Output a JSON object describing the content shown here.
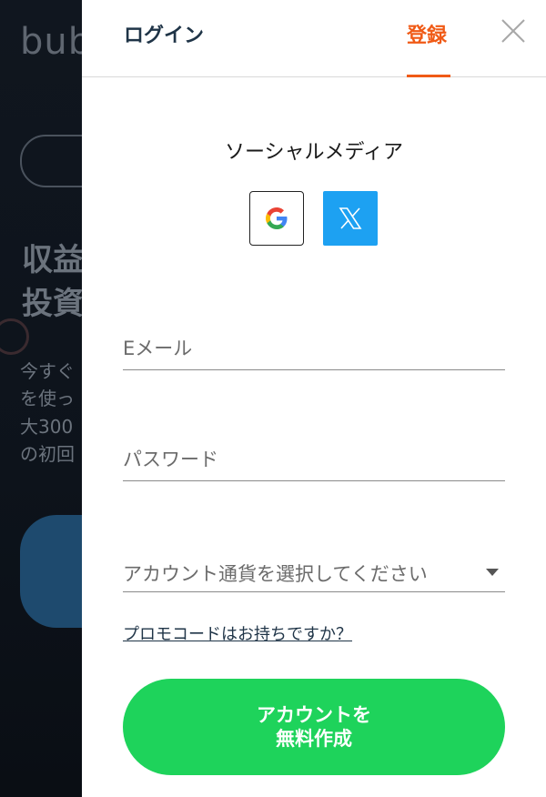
{
  "background_page": {
    "logo_text": "bub",
    "headline_lines": [
      "収益",
      "投資"
    ],
    "text_lines": [
      "今すぐ",
      "を使っ",
      "大300",
      "の初回"
    ]
  },
  "tabs": {
    "login_label": "ログイン",
    "register_label": "登録",
    "active": "register"
  },
  "social": {
    "title": "ソーシャルメディア",
    "buttons": [
      {
        "name": "google",
        "icon": "google-icon"
      },
      {
        "name": "x",
        "icon": "x-icon",
        "color": "#1da1f2"
      }
    ]
  },
  "form": {
    "email_placeholder": "Eメール",
    "email_value": "",
    "password_placeholder": "パスワード",
    "password_value": "",
    "currency_placeholder": "アカウント通貨を選択してください",
    "promo_link": "プロモコードはお持ちですか？",
    "submit_line1": "アカウントを",
    "submit_line2": "無料作成"
  },
  "colors": {
    "accent": "#f05a16",
    "primary_text": "#1f3447",
    "cta": "#1ed35b",
    "x_button": "#1da1f2"
  }
}
